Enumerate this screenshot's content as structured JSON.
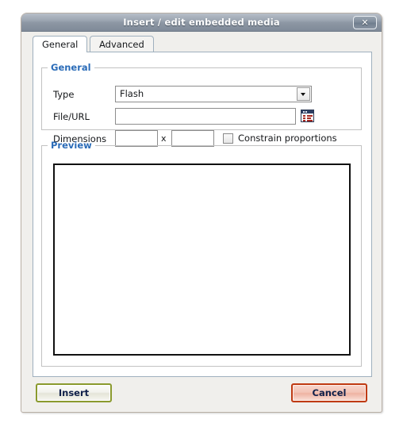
{
  "dialog": {
    "title": "Insert / edit embedded media",
    "close_label": "✕",
    "close_icon": "close-icon"
  },
  "tabs": [
    {
      "label": "General",
      "active": true
    },
    {
      "label": "Advanced",
      "active": false
    }
  ],
  "general_group": {
    "legend": "General",
    "type": {
      "label": "Type",
      "value": "Flash",
      "options": [
        "Flash"
      ],
      "arrow_icon": "chevron-down-icon"
    },
    "file_url": {
      "label": "File/URL",
      "value": "",
      "placeholder": "",
      "browse_icon": "browse-list-icon"
    },
    "dimensions": {
      "label": "Dimensions",
      "width_value": "",
      "height_value": "",
      "separator": "x",
      "constrain_label": "Constrain proportions",
      "constrain_checked": false
    }
  },
  "preview_group": {
    "legend": "Preview",
    "content": ""
  },
  "footer": {
    "insert_label": "Insert",
    "cancel_label": "Cancel"
  },
  "colors": {
    "legend_blue": "#2b6cb8",
    "titlebar_from": "#b7bec8",
    "titlebar_to": "#7f8a98",
    "insert_border": "#8a9a2e",
    "cancel_border": "#bf3a12",
    "dialog_bg": "#f0efec"
  }
}
